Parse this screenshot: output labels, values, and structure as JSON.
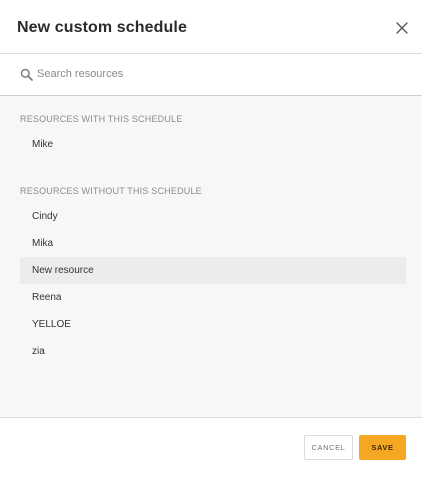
{
  "dialog": {
    "title": "New custom schedule"
  },
  "search": {
    "placeholder": "Search resources",
    "value": ""
  },
  "sections": {
    "with": {
      "label": "RESOURCES WITH THIS SCHEDULE",
      "items": [
        "Mike"
      ]
    },
    "without": {
      "label": "RESOURCES WITHOUT THIS SCHEDULE",
      "items": [
        "Cindy",
        "Mika",
        "New resource",
        "Reena",
        "YELLOE",
        "zia"
      ]
    }
  },
  "footer": {
    "cancel_label": "CANCEL",
    "save_label": "SAVE"
  },
  "colors": {
    "accent": "#f5a623",
    "list_background": "#f7f7f7",
    "hover_row": "#ececec"
  },
  "icons": {
    "close": "close-icon",
    "search": "search-icon"
  }
}
